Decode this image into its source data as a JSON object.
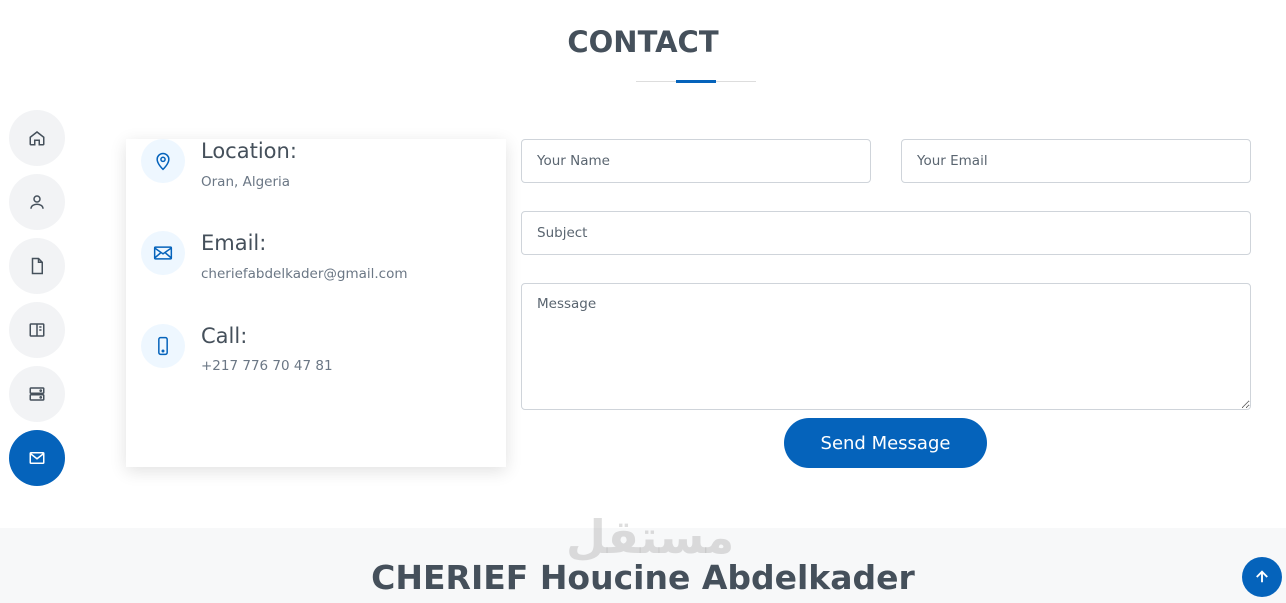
{
  "section": {
    "title": "CONTACT"
  },
  "side_nav": [
    {
      "icon": "home-icon",
      "label": "Home"
    },
    {
      "icon": "person-icon",
      "label": "About"
    },
    {
      "icon": "file-icon",
      "label": "Resume"
    },
    {
      "icon": "book-icon",
      "label": "Portfolio"
    },
    {
      "icon": "server-icon",
      "label": "Services"
    },
    {
      "icon": "envelope-icon",
      "label": "Contact",
      "active": true
    }
  ],
  "info": {
    "location": {
      "title": "Location:",
      "value": "Oran, Algeria",
      "icon": "map-pin-icon"
    },
    "email": {
      "title": "Email:",
      "value": "cheriefabdelkader@gmail.com",
      "icon": "envelope-icon"
    },
    "call": {
      "title": "Call:",
      "value": "+217 776 70 47 81",
      "icon": "phone-icon"
    }
  },
  "form": {
    "name_placeholder": "Your Name",
    "email_placeholder": "Your Email",
    "subject_placeholder": "Subject",
    "message_placeholder": "Message",
    "send_label": "Send Message"
  },
  "footer": {
    "name": "CHERIEF Houcine Abdelkader"
  },
  "watermark": {
    "text": "مستقل"
  },
  "colors": {
    "accent": "#0563bb",
    "heading": "#45505b",
    "nav_bg": "#f2f3f5"
  }
}
